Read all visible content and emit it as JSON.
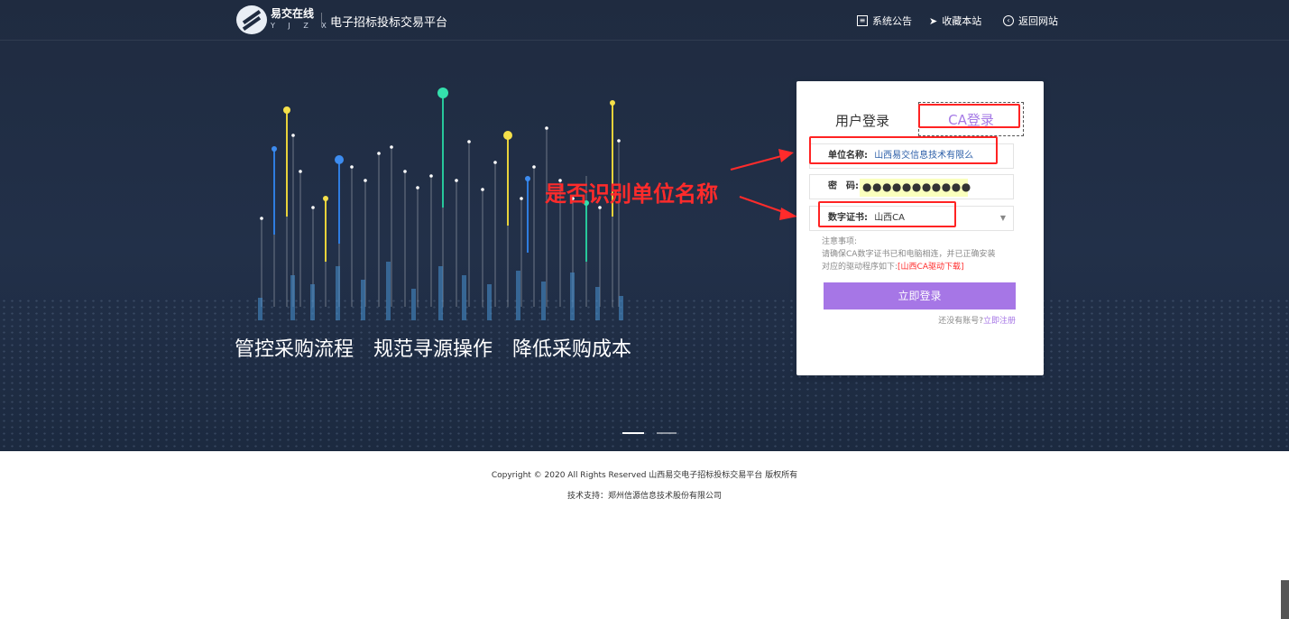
{
  "header": {
    "brand": "易交在线",
    "brand_sub": "Y J Z X",
    "platform": "电子招标投标交易平台",
    "nav": [
      {
        "icon": "document-icon",
        "label": "系统公告"
      },
      {
        "icon": "send-icon",
        "label": "收藏本站"
      },
      {
        "icon": "back-circle-icon",
        "label": "返回网站"
      }
    ]
  },
  "hero": {
    "slogan": "管控采购流程　规范寻源操作　降低采购成本",
    "annotation": "是否识别单位名称"
  },
  "login": {
    "tab_user": "用户登录",
    "tab_ca": "CA登录",
    "unit_label": "单位名称:",
    "unit_value": "山西易交信息技术有限么",
    "password_label": "密　码:",
    "password_mask": "●●●●●●●●●●●",
    "cert_label": "数字证书:",
    "cert_value": "山西CA",
    "notes_title": "注意事项:",
    "notes_line1": "请确保CA数字证书已和电脑相连，并已正确安装",
    "notes_line2": "对应的驱动程序如下:",
    "driver_link": "[山西CA驱动下载]",
    "submit": "立即登录",
    "register_prompt": "还没有账号?",
    "register_link": "立即注册"
  },
  "footer": {
    "copyright": "Copyright © 2020 All Rights Reserved 山西易交电子招标投标交易平台 版权所有",
    "support": "技术支持：郑州信源信息技术股份有限公司"
  },
  "colors": {
    "hero_bg": "#1f2b40",
    "accent_purple": "#a676e6",
    "annotation_red": "#ff2b2b"
  }
}
